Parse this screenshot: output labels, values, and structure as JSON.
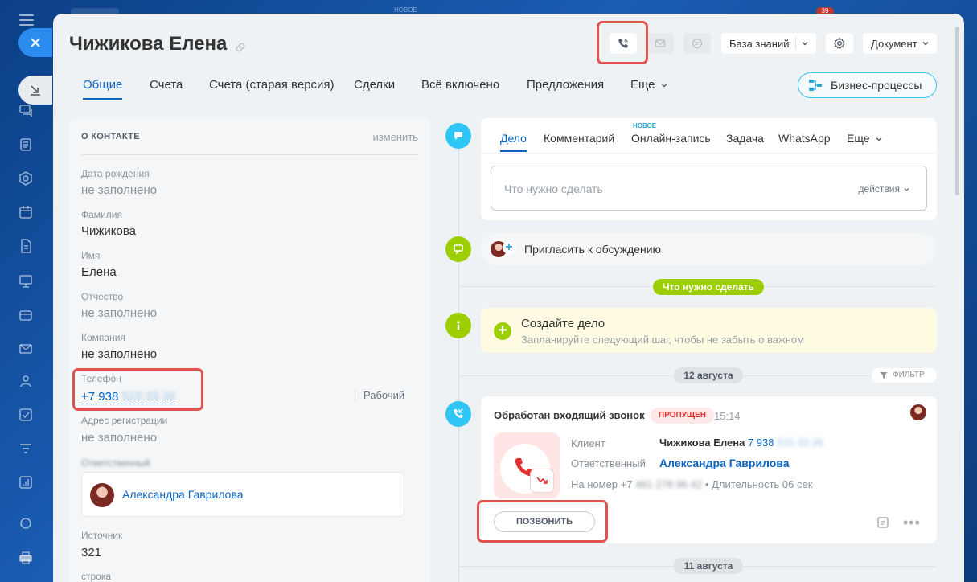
{
  "header": {
    "title": "Чижикова Елена",
    "knowledge_base": "База знаний",
    "document": "Документ",
    "business_processes": "Бизнес-процессы"
  },
  "background": {
    "new_label": "НОВОЕ",
    "counter": "39"
  },
  "tabs": [
    {
      "label": "Общие",
      "active": true
    },
    {
      "label": "Счета"
    },
    {
      "label": "Счета (старая версия)"
    },
    {
      "label": "Сделки"
    },
    {
      "label": "Всё включено"
    },
    {
      "label": "Предложения"
    },
    {
      "label": "Еще"
    }
  ],
  "contact": {
    "heading": "О КОНТАКТЕ",
    "edit": "изменить",
    "birth_label": "Дата рождения",
    "birth_value": "не заполнено",
    "surname_label": "Фамилия",
    "surname_value": "Чижикова",
    "name_label": "Имя",
    "name_value": "Елена",
    "patronymic_label": "Отчество",
    "patronymic_value": "не заполнено",
    "company_label": "Компания",
    "company_value": "не заполнено",
    "phone_label": "Телефон",
    "phone_visible": "+7 938",
    "phone_hidden": "515 33 26",
    "phone_type": "Рабочий",
    "address_label": "Адрес регистрации",
    "address_value": "не заполнено",
    "responsible_label": "Ответственный",
    "responsible_name": "Александра Гаврилова",
    "source_label": "Источник",
    "source_value": "321",
    "string_label": "строка"
  },
  "composer": {
    "tabs": [
      "Дело",
      "Комментарий",
      "Онлайн-запись",
      "Задача",
      "WhatsApp",
      "Еще"
    ],
    "new_badge": "НОВОЕ",
    "placeholder": "Что нужно сделать",
    "actions": "действия"
  },
  "invite": {
    "text": "Пригласить к обсуждению"
  },
  "todo_pill": "Что нужно сделать",
  "todo": {
    "title": "Создайте дело",
    "subtitle": "Запланируйте следующий шаг, чтобы не забыть о важном"
  },
  "date_pill_1": "12 августа",
  "filter": "ФИЛЬТР",
  "call": {
    "title": "Обработан входящий звонок",
    "status": "ПРОПУЩЕН",
    "time": "15:14",
    "client_label": "Клиент",
    "client_name": "Чижикова Елена",
    "client_phone": "7 938",
    "client_phone_hidden": "515 33 26",
    "responsible_label": "Ответственный",
    "responsible_name": "Александра Гаврилова",
    "number_label": "На номер",
    "number_visible": "+7",
    "number_hidden": "461 278 96 42",
    "duration": "• Длительность 06 сек",
    "callback": "ПОЗВОНИТЬ"
  },
  "date_pill_2": "11 августа",
  "colors": {
    "accent": "#0b66c3",
    "green": "#9dcf00",
    "timeline_blue": "#2fc6f6",
    "missed_red": "#e62e2e",
    "highlight": "#e2524f"
  }
}
